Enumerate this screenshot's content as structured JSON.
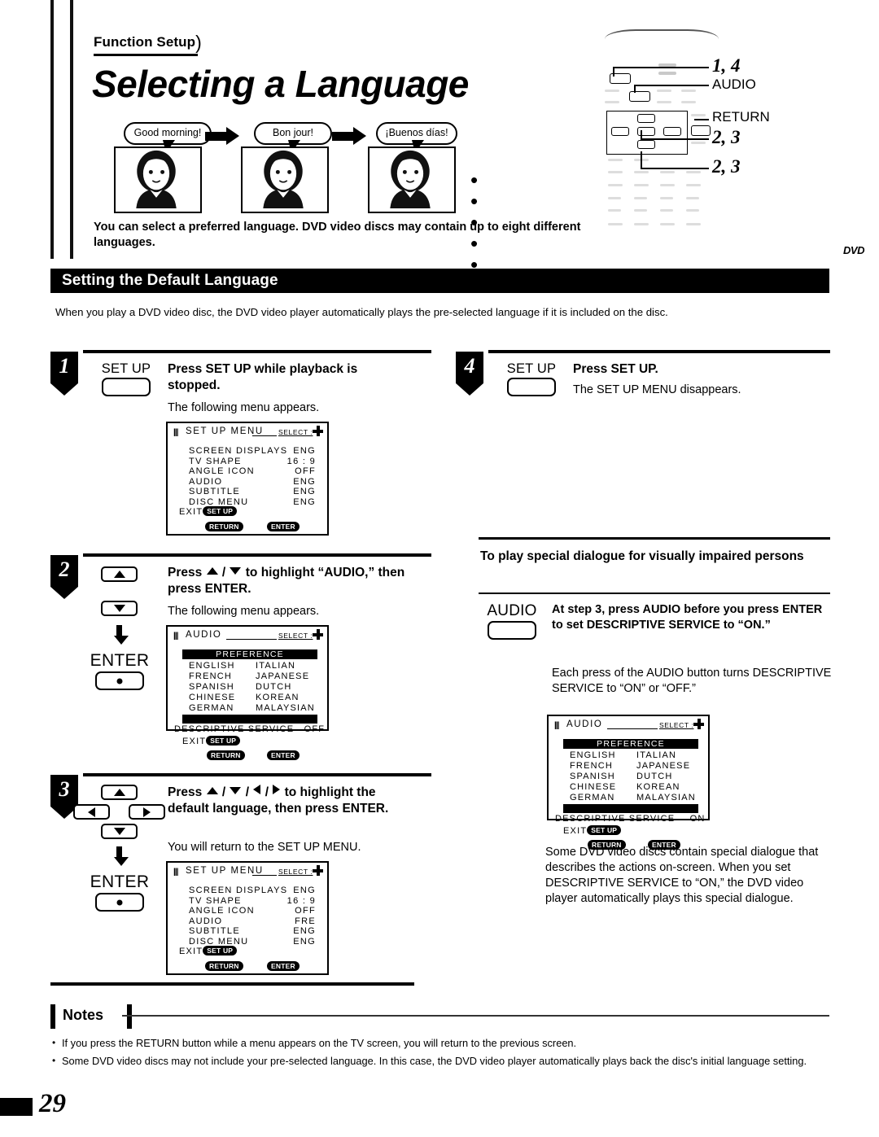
{
  "header": {
    "kicker": "Function Setup",
    "title": "Selecting a Language",
    "intro": "You can select a preferred language. DVD video discs may contain up to eight different languages."
  },
  "illustration": {
    "bubbles": [
      "Good morning!",
      "Bon jour!",
      "¡Buenos días!"
    ],
    "ellipsis": "• • • • •"
  },
  "remote": {
    "callouts": [
      "1, 4",
      "AUDIO",
      "RETURN",
      "2, 3",
      "2, 3"
    ],
    "logo": "DVD"
  },
  "section": {
    "banner_title": "Setting the Default Language",
    "banner_sub": "When you play a DVD video disc, the DVD video player automatically plays the pre-selected language if it is included on the disc."
  },
  "steps": [
    {
      "number": "1",
      "key_label": "SET UP",
      "heading": "Press SET UP while playback is stopped.",
      "sub": "The following menu appears."
    },
    {
      "number": "2",
      "key_label": "ENTER",
      "heading_pre": "Press ",
      "heading_mid": " / ",
      "heading_post": " to highlight “AUDIO,” then press ENTER.",
      "sub": "The following menu appears."
    },
    {
      "number": "3",
      "key_label": "ENTER",
      "heading_pre": "Press ",
      "heading_post": " to highlight the default language, then press ENTER.",
      "sub": "You will return to the SET UP MENU."
    },
    {
      "number": "4",
      "key_label": "SET UP",
      "heading": "Press SET UP.",
      "sub": "The SET UP MENU disappears."
    }
  ],
  "osd_setup_menu_1": {
    "title": "SET UP MENU",
    "select": "SELECT :",
    "rows": [
      {
        "label": "SCREEN DISPLAYS",
        "value": "ENG"
      },
      {
        "label": "TV SHAPE",
        "value": "16 : 9"
      },
      {
        "label": "ANGLE ICON",
        "value": "OFF"
      },
      {
        "label": "AUDIO",
        "value": "ENG"
      },
      {
        "label": "SUBTITLE",
        "value": "ENG"
      },
      {
        "label": "DISC MENU",
        "value": "ENG"
      }
    ],
    "exit": "EXIT",
    "pill_setup": "SET UP",
    "pill_return": "RETURN",
    "pill_enter": "ENTER"
  },
  "osd_setup_menu_2": {
    "title": "SET UP MENU",
    "select": "SELECT :",
    "rows": [
      {
        "label": "SCREEN DISPLAYS",
        "value": "ENG"
      },
      {
        "label": "TV SHAPE",
        "value": "16 : 9"
      },
      {
        "label": "ANGLE ICON",
        "value": "OFF"
      },
      {
        "label": "AUDIO",
        "value": "FRE"
      },
      {
        "label": "SUBTITLE",
        "value": "ENG"
      },
      {
        "label": "DISC MENU",
        "value": "ENG"
      }
    ],
    "exit": "EXIT",
    "pill_setup": "SET UP",
    "pill_return": "RETURN",
    "pill_enter": "ENTER"
  },
  "osd_audio_off": {
    "title": "AUDIO",
    "select": "SELECT :",
    "preference": "PREFERENCE",
    "languages_left": [
      "ENGLISH",
      "FRENCH",
      "SPANISH",
      "CHINESE",
      "GERMAN"
    ],
    "languages_right": [
      "ITALIAN",
      "JAPANESE",
      "DUTCH",
      "KOREAN",
      "MALAYSIAN"
    ],
    "descriptive_label": "DESCRIPTIVE SERVICE",
    "descriptive_value": "OFF",
    "exit": "EXIT",
    "pill_setup": "SET UP",
    "pill_return": "RETURN",
    "pill_enter": "ENTER"
  },
  "osd_audio_on": {
    "title": "AUDIO",
    "select": "SELECT :",
    "preference": "PREFERENCE",
    "languages_left": [
      "ENGLISH",
      "FRENCH",
      "SPANISH",
      "CHINESE",
      "GERMAN"
    ],
    "languages_right": [
      "ITALIAN",
      "JAPANESE",
      "DUTCH",
      "KOREAN",
      "MALAYSIAN"
    ],
    "descriptive_label": "DESCRIPTIVE SERVICE",
    "descriptive_value": "ON",
    "exit": "EXIT",
    "pill_setup": "SET UP",
    "pill_return": "RETURN",
    "pill_enter": "ENTER"
  },
  "special": {
    "heading": "To play special dialogue for visually impaired persons",
    "key_label": "AUDIO",
    "instruction": "At step 3, press AUDIO before you press ENTER to set DESCRIPTIVE SERVICE to “ON.”",
    "note": "Each press of the AUDIO button turns DESCRIPTIVE SERVICE to “ON” or “OFF.”",
    "paragraph": "Some DVD video discs contain special dialogue that describes the actions on-screen. When you set DESCRIPTIVE SERVICE to “ON,” the DVD video player automatically plays this special dialogue."
  },
  "notes": {
    "label": "Notes",
    "items": [
      "If you press the RETURN button while a menu appears on the TV screen, you will return to the previous screen.",
      "Some DVD video discs may not include your pre-selected language. In this case, the DVD video player automatically plays back the disc's initial language setting."
    ]
  },
  "footer": {
    "page_number": "29"
  }
}
